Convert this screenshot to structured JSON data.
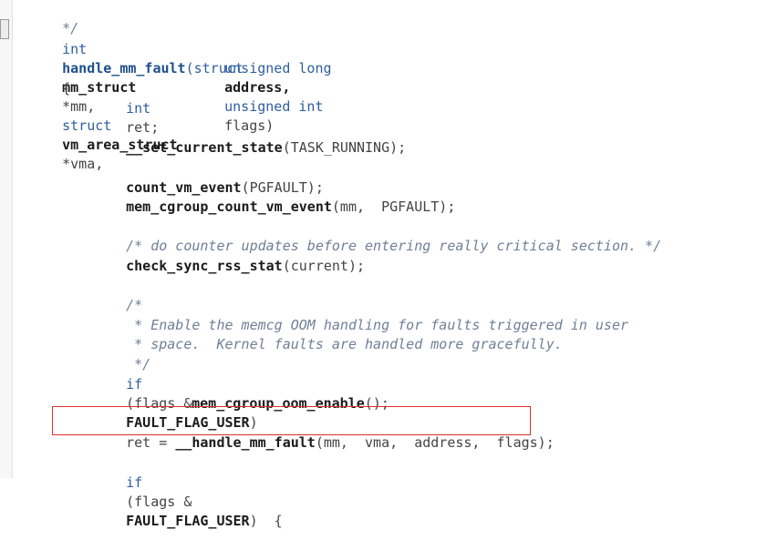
{
  "editor": {
    "lines": {
      "l0": {
        "cm": "*/"
      },
      "l1": {
        "kw": "int",
        "fn": "handle_mm_fault",
        "p1": "(struct",
        "a1": "mm_struct",
        "s1": "*mm,",
        "p2": "struct",
        "a2": "vm_area_struct",
        "s2": "*vma,"
      },
      "l2": {
        "t1": "unsigned long",
        "a1": "address,",
        "t2": "unsigned int",
        "a2": "flags)"
      },
      "l3": {
        "text": "{"
      },
      "l4": {
        "t": "int",
        "v": "ret;"
      },
      "l5": {
        "fn": "__set_current_state",
        "a": "(TASK_RUNNING);"
      },
      "l6": {
        "fn": "count_vm_event",
        "a": "(PGFAULT);"
      },
      "l7": {
        "fn": "mem_cgroup_count_vm_event",
        "a": "(mm,  PGFAULT);"
      },
      "l8": {
        "cm": "/* do counter updates before entering really critical section. */"
      },
      "l9": {
        "fn": "check_sync_rss_stat",
        "a": "(current);"
      },
      "l10": {
        "cm": "/*"
      },
      "l11": {
        "cm": " * Enable the memcg OOM handling for faults triggered in user"
      },
      "l12": {
        "cm": " * space.  Kernel faults are handled more gracefully."
      },
      "l13": {
        "cm": " */"
      },
      "l14": {
        "kw": "if",
        "a": "(flags &",
        "b": "FAULT_FLAG_USER",
        "c": ")"
      },
      "l15": {
        "fn": "mem_cgroup_oom_enable",
        "a": "();"
      },
      "l16": {
        "pre": "ret = ",
        "fn": "__handle_mm_fault",
        "a": "(mm,  vma,  address,  flags);"
      },
      "l17": {
        "kw": "if",
        "a": "(flags &",
        "b": "FAULT_FLAG_USER",
        "c": ")  {"
      }
    }
  }
}
